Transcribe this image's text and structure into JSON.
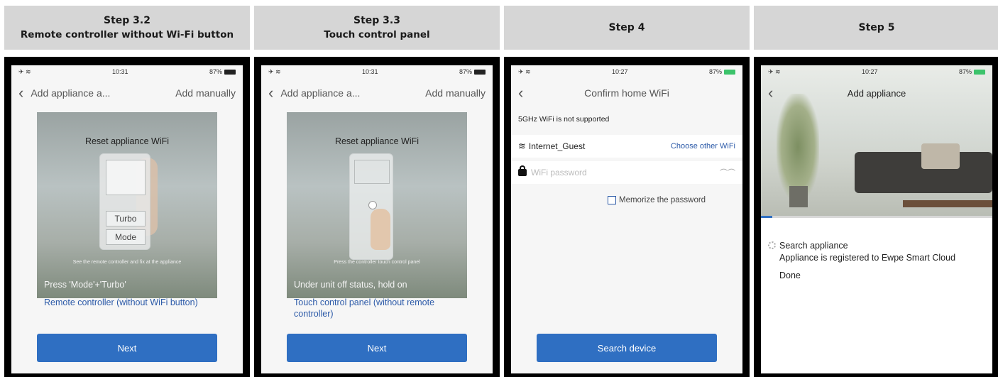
{
  "steps": [
    {
      "title": "Step 3.2",
      "subtitle": "Remote controller without Wi-Fi button"
    },
    {
      "title": "Step 3.3",
      "subtitle": "Touch control panel"
    },
    {
      "title": "Step 4"
    },
    {
      "title": "Step 5"
    }
  ],
  "screen1": {
    "status_time": "10:31",
    "status_battery": "87%",
    "nav_title": "Add appliance a...",
    "nav_right": "Add manually",
    "illus_title": "Reset appliance WiFi",
    "btn_turbo": "Turbo",
    "btn_mode": "Mode",
    "hint": "See the remote controller and fix at the appliance",
    "overlay": "Press 'Mode'+'Turbo'",
    "link": "Remote controller (without WiFi button)",
    "next": "Next"
  },
  "screen2": {
    "status_time": "10:31",
    "status_battery": "87%",
    "nav_title": "Add appliance a...",
    "nav_right": "Add manually",
    "illus_title": "Reset appliance WiFi",
    "hint": "Press the controller touch control panel",
    "overlay": "Under unit off status, hold on",
    "link": "Touch control panel (without remote controller)",
    "next": "Next"
  },
  "screen3": {
    "status_time": "10:27",
    "status_battery": "87%",
    "nav_title": "Confirm home WiFi",
    "warning": "5GHz WiFi is not supported",
    "ssid": "Internet_Guest",
    "choose_other": "Choose other  WiFi",
    "password_placeholder": "WiFi password",
    "memorize": "Memorize the password",
    "search": "Search device"
  },
  "screen4": {
    "status_time": "10:27",
    "status_battery": "87%",
    "nav_title": "Add appliance",
    "progress": 0.05,
    "item_search": "Search appliance",
    "item_registered": "Appliance is registered to Ewpe Smart Cloud",
    "item_done": "Done"
  },
  "icons": {
    "back": "chevron-left-icon",
    "wifi": "wifi-icon",
    "lock": "lock-icon",
    "eye": "eye-closed-icon",
    "spinner": "loading-spinner-icon"
  },
  "colors": {
    "header_bg": "#d6d6d6",
    "primary_button": "#2f6fc2",
    "link": "#2c5aa8",
    "frame": "#000000"
  }
}
